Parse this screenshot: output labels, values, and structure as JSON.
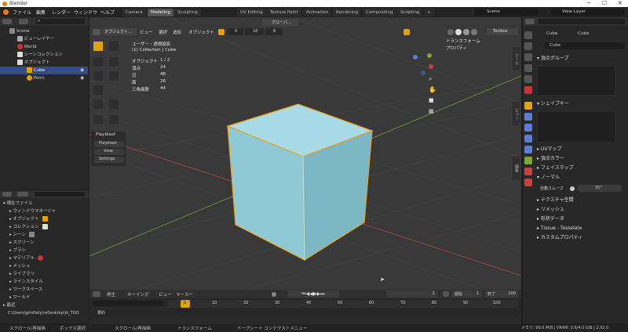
{
  "window": {
    "title": "Blender"
  },
  "menu": [
    "ファイル",
    "編集",
    "レンダー",
    "ウィンドウ",
    "ヘルプ"
  ],
  "workspaces": [
    "Camera",
    "Modeling",
    "Sculpting",
    "UV Editing",
    "Texture Paint",
    "Animation",
    "Rendering",
    "Compositing",
    "Scripting"
  ],
  "active_workspace": "Modeling",
  "scene_field": "Scene",
  "view_layer_field": "View Layer",
  "outliner": {
    "rows": [
      "Scene",
      "ビューレイヤー",
      "World",
      "シーンコレクション",
      "オブジェクト",
      "Cube",
      "Point"
    ]
  },
  "viewport_header": {
    "mode": "オブジェクト...",
    "menus": [
      "ビュー",
      "選択",
      "追加",
      "オブジェクト"
    ],
    "field1": "0",
    "field2": "18",
    "field3": "8",
    "transform_menu": "グローバ..."
  },
  "viewport_info": {
    "line1": "ユーザー・透視投影",
    "line2": "(1) Collection | Cube",
    "stats_labels": [
      "オブジェクト",
      "頂点",
      "辺",
      "面",
      "三角面数"
    ],
    "stats_values": [
      "1 / 2",
      "24",
      "48",
      "26",
      "44"
    ]
  },
  "n_panel": {
    "items": [
      "トランスフォーム",
      "プロパティ"
    ],
    "toolbox": "Toolbox"
  },
  "playblast": {
    "title": "Playblast",
    "buttons": [
      "Playblast",
      "View",
      "Settings"
    ]
  },
  "data_browser": {
    "rows": [
      "現在ファイル",
      "ウィンドウマネージャ",
      "オブジェクト",
      "コレクション",
      "シーン",
      "スクリーン",
      "ブラシ",
      "マテリアル",
      "メッシュ",
      "ライブラリ",
      "ラインスタイル",
      "ワークスペース",
      "ワールド",
      "最近"
    ],
    "path": "C:\\Users\\gimPally\\reDesktop\\bl_TOO"
  },
  "timeline": {
    "menus": [
      "再生",
      "キーイング",
      "ビュー",
      "マーカー"
    ],
    "current_frame": "1",
    "start_label": "開始",
    "start": "1",
    "end_label": "終了",
    "end": "100",
    "ticks": [
      "0",
      "10",
      "20",
      "30",
      "40",
      "50",
      "60",
      "70",
      "80",
      "90",
      "100"
    ],
    "summary": "要約"
  },
  "properties": {
    "object_name": "Cube",
    "data_name": "Cube",
    "mesh_field": "Cube",
    "sections": [
      "頂点グループ",
      "シェイプキー",
      "UVマップ",
      "頂点カラー",
      "フェイスマップ",
      "ノーマル",
      "テクスチャ空間",
      "リメッシュ",
      "形状データ",
      "Tissue - Tesselate",
      "カスタムプロパティ"
    ],
    "autosmooth_label": "自動スムーズ",
    "autosmooth_value": "35°"
  },
  "status_bar": {
    "items": [
      "スクロール/再描画",
      "ボックス選択",
      "スクロール/再描画",
      "トランスフォーム",
      "ドープシート コンテクストメニュー"
    ],
    "right": "メモリ: 99.0 MiB | VRAM: 0.6/4.0 GiB | 2.92.0"
  },
  "colors": {
    "accent": "#e0a20c",
    "selection": "#334d80",
    "cube": "#8fc9d6",
    "grid_x": "#b04a4a",
    "grid_y": "#7e9a3a"
  }
}
